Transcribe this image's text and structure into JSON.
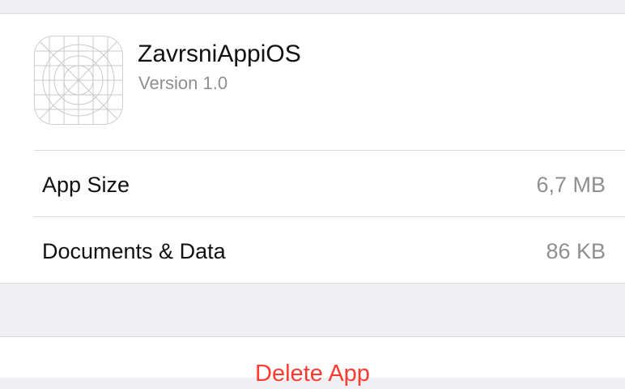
{
  "app": {
    "name": "ZavrsniAppiOS",
    "version": "Version 1.0",
    "icon": "app-icon-placeholder-grid"
  },
  "rows": [
    {
      "label": "App Size",
      "value": "6,7 MB"
    },
    {
      "label": "Documents & Data",
      "value": "86 KB"
    }
  ],
  "actions": {
    "delete_label": "Delete App"
  },
  "colors": {
    "background": "#efeff4",
    "cell": "#ffffff",
    "separator": "#d8d8dc",
    "primary_text": "#111111",
    "secondary_text": "#8e8e93",
    "destructive": "#ff3b30"
  }
}
